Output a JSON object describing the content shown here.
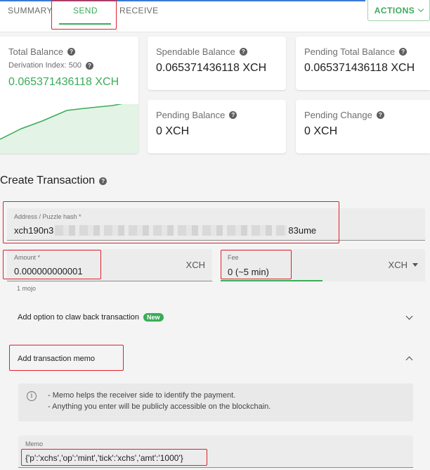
{
  "tabs": {
    "summary": "SUMMARY",
    "send": "SEND",
    "receive": "RECEIVE"
  },
  "actions_label": "ACTIONS",
  "balances": {
    "total": {
      "label": "Total Balance",
      "derivation": "Derivation Index: 500",
      "value": "0.065371436118 XCH"
    },
    "spendable": {
      "label": "Spendable Balance",
      "value": "0.065371436118 XCH"
    },
    "pending_total": {
      "label": "Pending Total Balance",
      "value": "0.065371436118 XCH"
    },
    "pending_balance": {
      "label": "Pending Balance",
      "value": "0 XCH"
    },
    "pending_change": {
      "label": "Pending Change",
      "value": "0 XCH"
    }
  },
  "create": {
    "title": "Create Transaction",
    "address_label": "Address / Puzzle hash *",
    "address_start": "xch190n3",
    "address_end": "83ume",
    "amount_label": "Amount *",
    "amount_value": "0.000000000001",
    "amount_unit": "XCH",
    "amount_helper": "1 mojo",
    "fee_label": "Fee",
    "fee_value": "0 (~5 min)",
    "fee_unit": "XCH",
    "clawback_label": "Add option to claw back transaction",
    "clawback_badge": "New",
    "memo_section_label": "Add transaction memo",
    "info_line1": "- Memo helps the receiver side to identify the payment.",
    "info_line2": "- Anything you enter will be publicly accessible on the blockchain.",
    "memo_label": "Memo",
    "memo_value": "{'p':'xchs','op':'mint','tick':'xchs','amt':'1000'}"
  },
  "colors": {
    "accent_green": "#3aac59",
    "highlight_red": "#e0202c"
  }
}
